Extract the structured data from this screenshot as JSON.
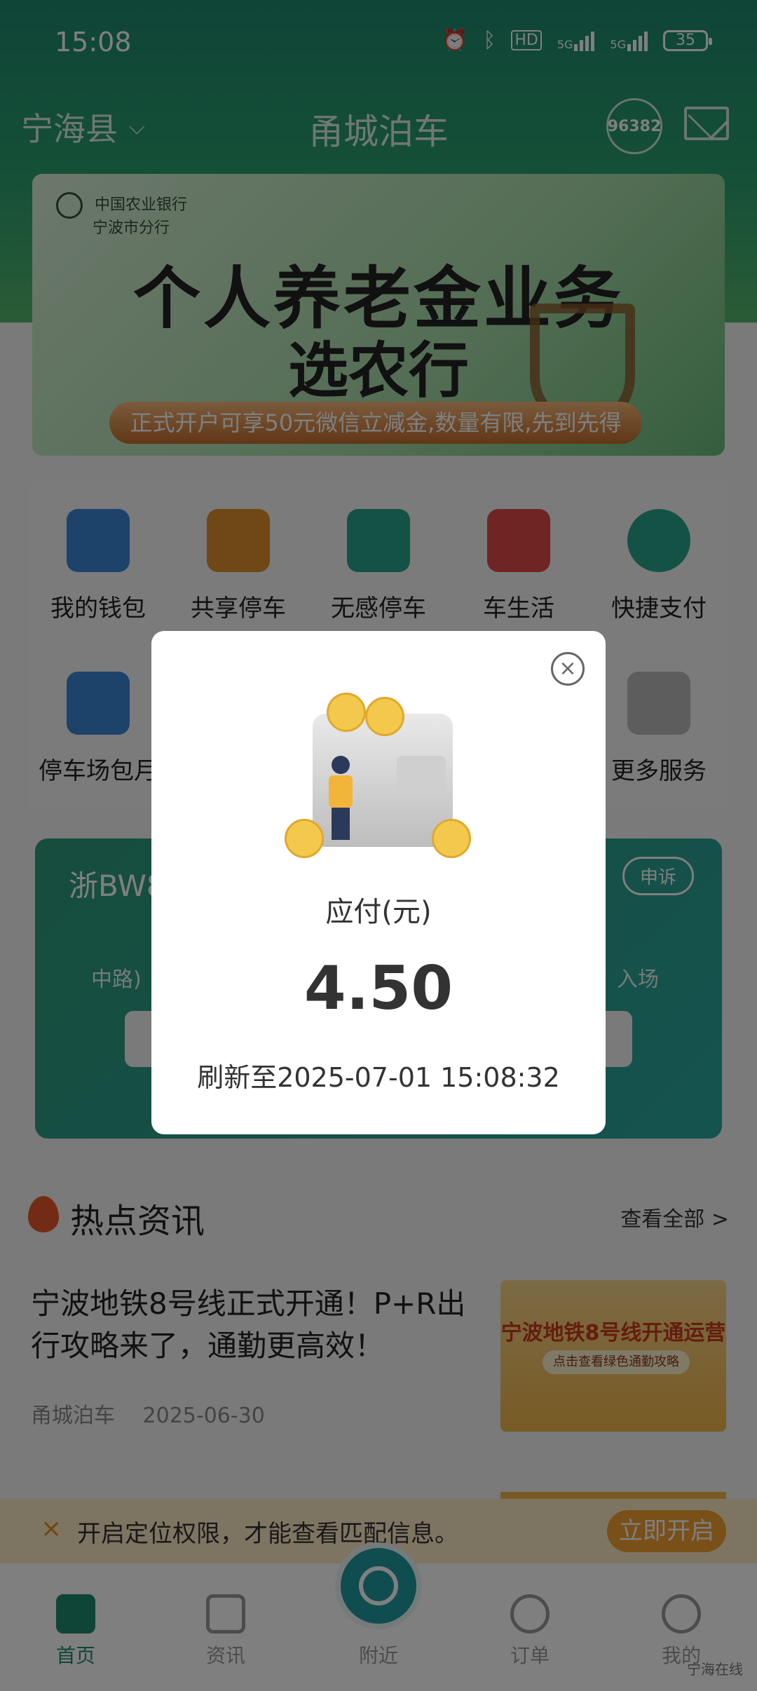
{
  "status_bar": {
    "time": "15:08",
    "battery": "35",
    "hd_label": "HD",
    "net1": "5G",
    "net2": "5G"
  },
  "topbar": {
    "city": "宁海县",
    "title": "甬城泊车",
    "hotline": "96382"
  },
  "banner": {
    "bank_name": "中国农业银行",
    "bank_branch": "宁波市分行",
    "headline1": "个人养老金业务",
    "headline2": "选农行",
    "promo": "正式开户可享50元微信立减金,数量有限,先到先得"
  },
  "grid": {
    "items": [
      {
        "label": "我的钱包",
        "icon": "wallet-icon",
        "color": "#3b86d6"
      },
      {
        "label": "共享停车",
        "icon": "shared-parking-icon",
        "color": "#e0902a"
      },
      {
        "label": "无感停车",
        "icon": "hot-parking-icon",
        "color": "#2aa48c"
      },
      {
        "label": "车生活",
        "icon": "car-life-icon",
        "color": "#e04a4a"
      },
      {
        "label": "快捷支付",
        "icon": "yuan-pay-icon",
        "color": "#2aa48c"
      },
      {
        "label": "停车场包月",
        "icon": "monthly-parking-icon",
        "color": "#3b86d6"
      },
      {
        "label": "更多服务",
        "icon": "more-services-icon",
        "color": "#bbbbbb"
      }
    ]
  },
  "parking_card": {
    "plate_prefix": "浙BW8",
    "appeal": "申诉",
    "road_suffix": "中路)",
    "entry_suffix": "入场"
  },
  "news": {
    "section_title": "热点资讯",
    "view_all": "查看全部 >",
    "article": {
      "title": "宁波地铁8号线正式开通！P+R出行攻略来了，通勤更高效！",
      "source": "甬城泊车",
      "date": "2025-06-30",
      "thumb_title": "宁波地铁8号线开通运营",
      "thumb_sub": "点击查看绿色通勤攻略"
    }
  },
  "location_bar": {
    "close": "×",
    "text": "开启定位权限，才能查看匹配信息。",
    "button": "立即开启"
  },
  "tabbar": {
    "tabs": [
      {
        "label": "首页",
        "active": true
      },
      {
        "label": "资讯",
        "active": false
      },
      {
        "label": "附近",
        "active": false
      },
      {
        "label": "订单",
        "active": false
      },
      {
        "label": "我的",
        "active": false
      }
    ]
  },
  "watermark": "宁海在线",
  "modal": {
    "close_symbol": "×",
    "pay_label": "应付(元)",
    "amount": "4.50",
    "refresh_text": "刷新至2025-07-01 15:08:32"
  }
}
